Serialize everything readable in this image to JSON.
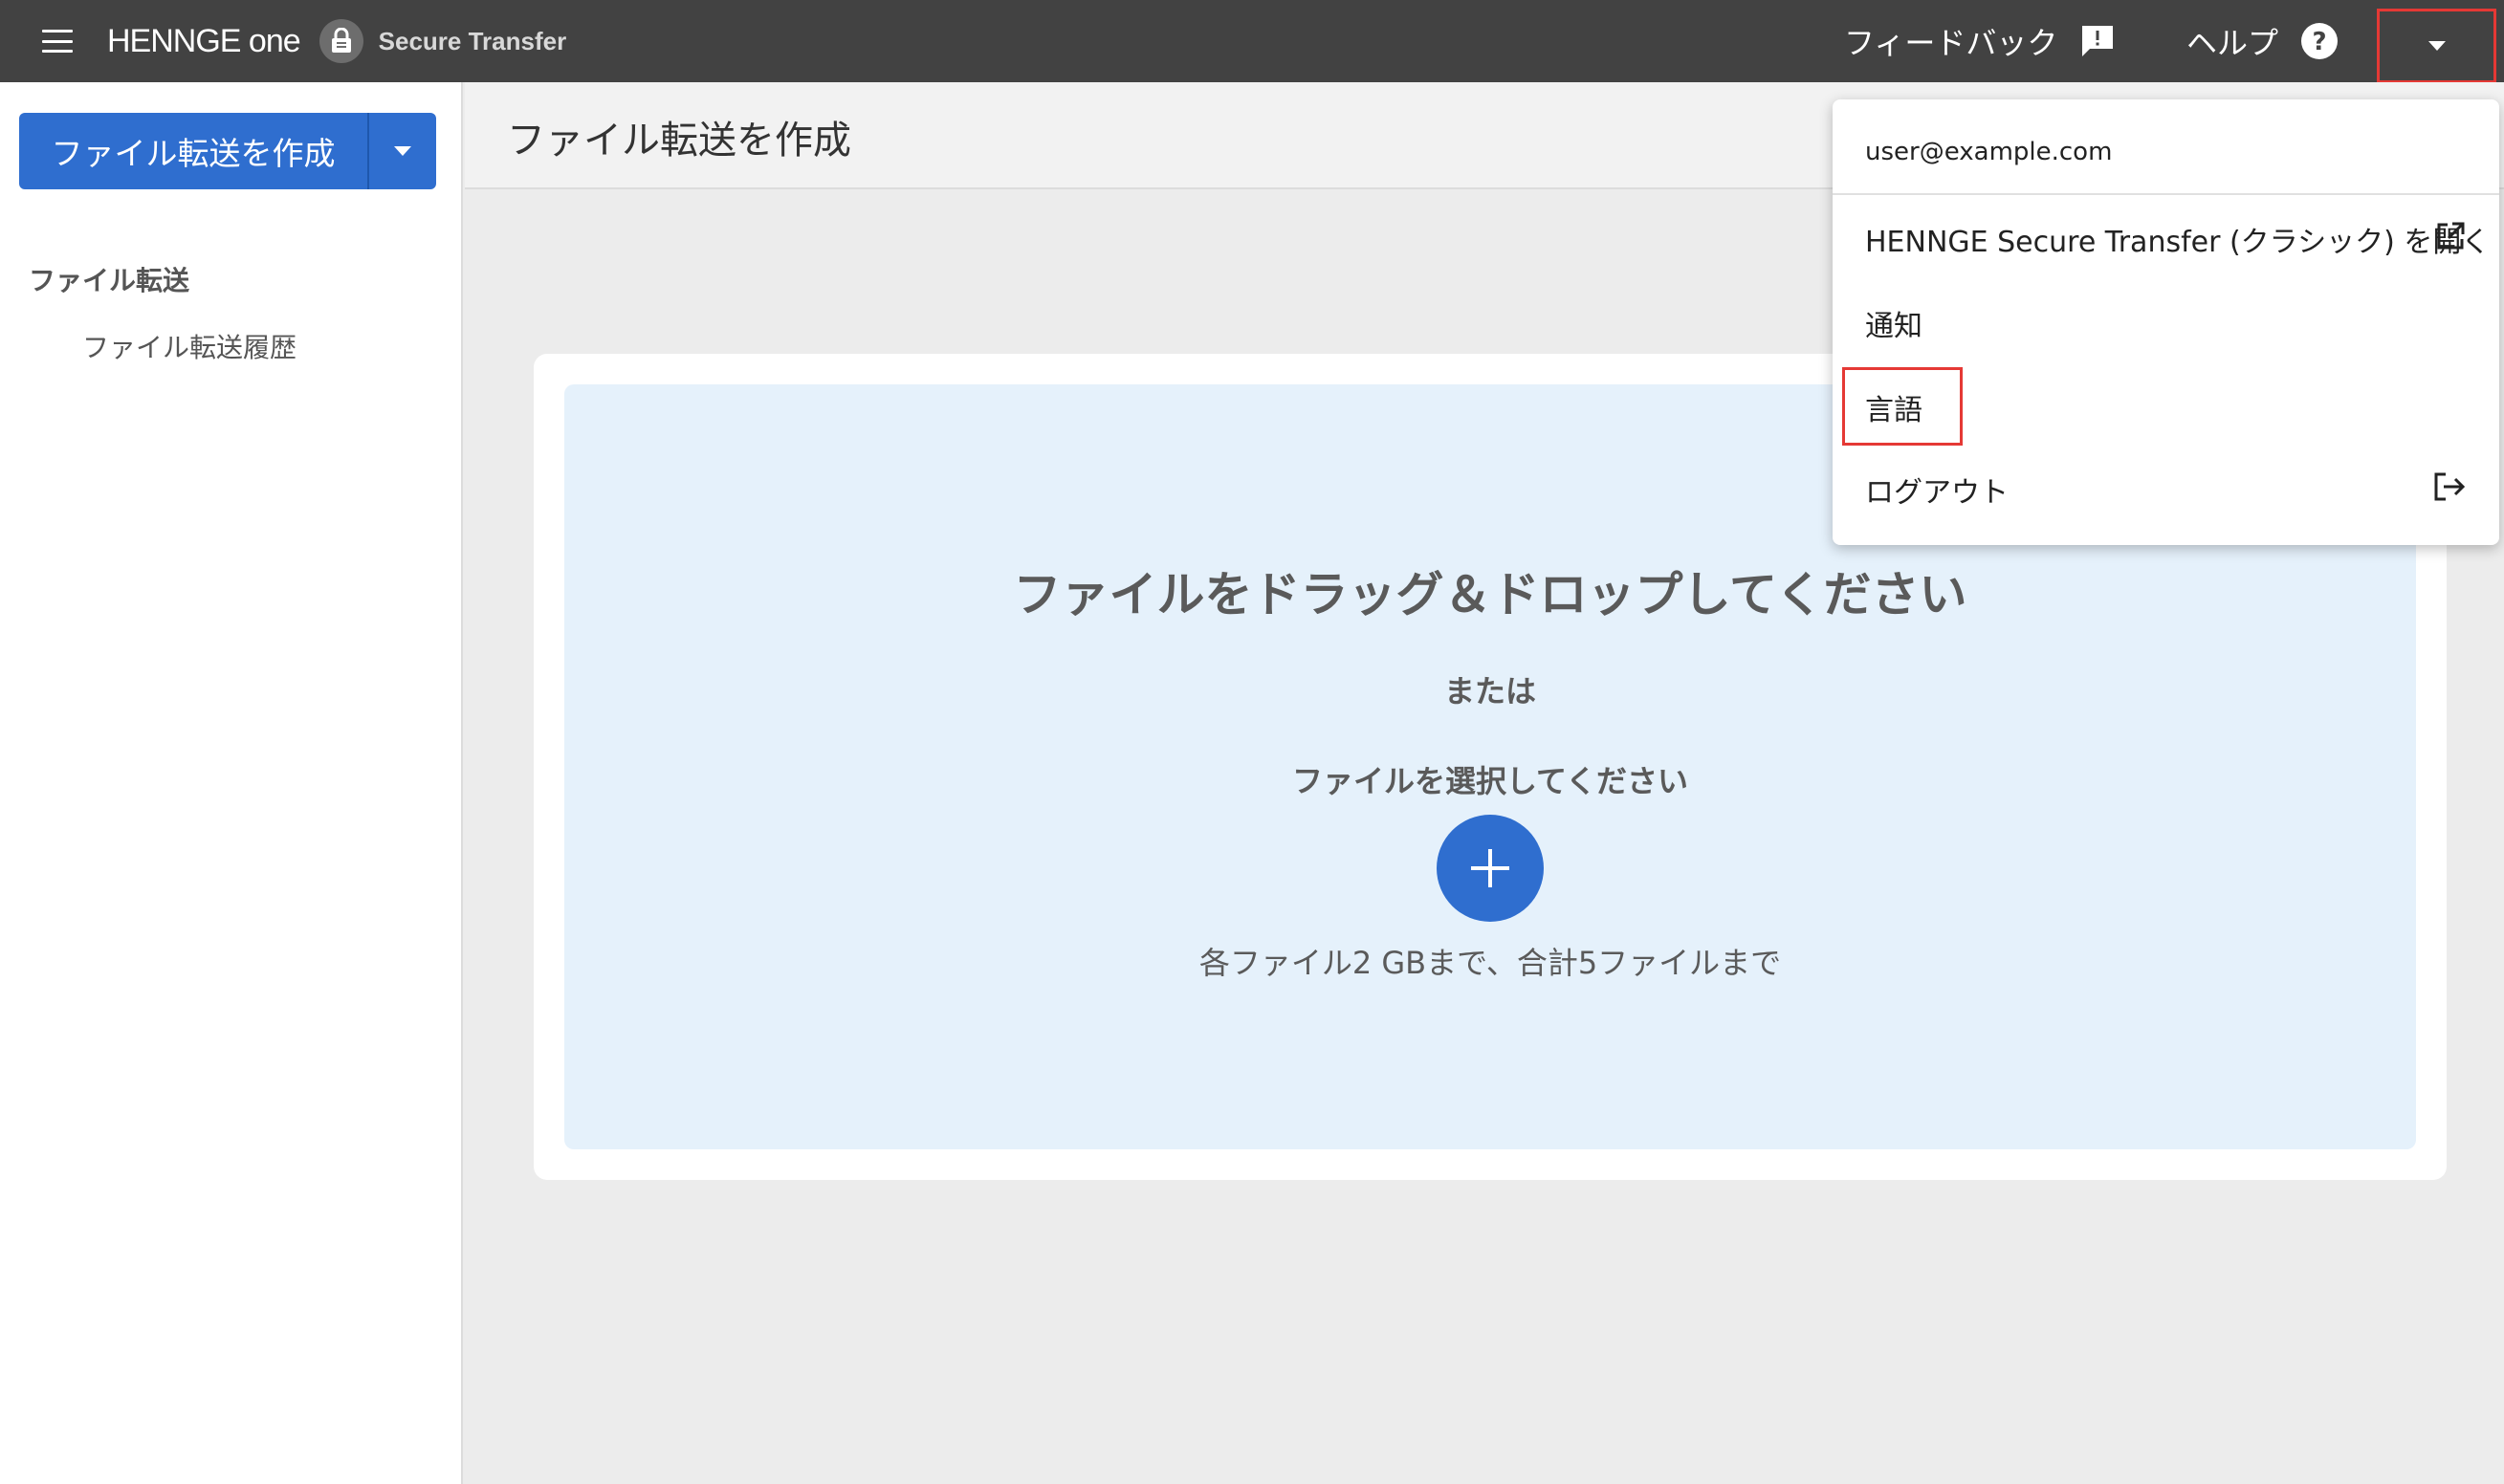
{
  "topbar": {
    "brand_logo": "HENNGE one",
    "brand_product": "Secure Transfer",
    "feedback_label": "フィードバック",
    "help_label": "ヘルプ"
  },
  "sidebar": {
    "create_button_label": "ファイル転送を作成",
    "section_title": "ファイル転送",
    "items": [
      {
        "label": "ファイル転送履歴"
      }
    ]
  },
  "main": {
    "page_title": "ファイル転送を作成",
    "dropzone": {
      "title": "ファイルをドラッグ＆ドロップしてください",
      "or_text": "または",
      "select_text": "ファイルを選択してください",
      "limit_text": "各ファイル2 GBまで、合計5ファイルまで"
    }
  },
  "account_menu": {
    "email": "user@example.com",
    "items": [
      {
        "label": "HENNGE Secure Transfer (クラシック) を開く",
        "icon": "external-link-icon"
      },
      {
        "label": "通知"
      },
      {
        "label": "言語"
      },
      {
        "label": "ログアウト",
        "icon": "logout-icon"
      }
    ]
  },
  "colors": {
    "topbar": "#424242",
    "primary": "#2f6ecf",
    "dropzone": "#e5f1fb",
    "highlight": "#e53935"
  }
}
